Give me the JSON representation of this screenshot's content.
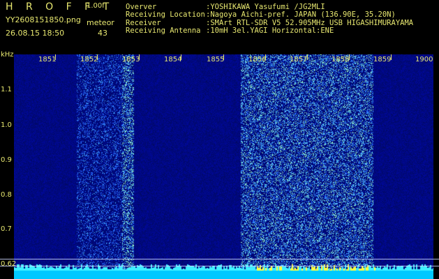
{
  "header": {
    "app_name": "H R O F F T",
    "version": "1.00f",
    "filename": "YY2608151850.png",
    "meteor_label": "meteor",
    "datetime": "26.08.15 18:50",
    "meteor_count": "43"
  },
  "info": [
    {
      "key": "Overver",
      "value": ":YOSHIKAWA Yasufumi /JG2MLI"
    },
    {
      "key": "Receiving Location",
      "value": ":Nagoya Aichi-pref. JAPAN (136.90E, 35.20N)"
    },
    {
      "key": "Receiver",
      "value": ":SMArt RTL-SDR V5 52.905MHz USB HIGASHIMURAYAMA"
    },
    {
      "key": "Receiving Antenna",
      "value": ":10mH 3el.YAGI Horizontal:ENE"
    }
  ],
  "axis": {
    "y_unit": "kHz",
    "y_ticks": [
      "1.1",
      "1.0",
      "0.9",
      "0.8",
      "0.7",
      "0.62"
    ],
    "x_ticks": [
      "1851",
      "1852",
      "1853",
      "1854",
      "1855",
      "1856",
      "1857",
      "1858",
      "1859",
      "1900"
    ]
  },
  "colors": {
    "background": "#000000",
    "text": "#e8e870",
    "spectrum_base": "#00107a",
    "spectrum_hot": "#2a6cff",
    "baseline": "#00e0ff"
  }
}
